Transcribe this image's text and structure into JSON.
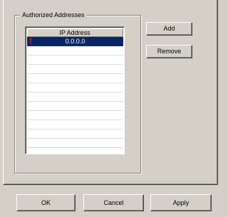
{
  "authorized": {
    "group_title": "Authorized Addresses",
    "column_header": "IP Address",
    "rows": [
      {
        "flag": "!",
        "ip": "0.0.0.0",
        "selected": true
      }
    ]
  },
  "buttons": {
    "add": "Add",
    "remove": "Remove",
    "ok": "OK",
    "cancel": "Cancel",
    "apply": "Apply"
  },
  "colors": {
    "dialog_background": "#d4d0c8",
    "selection_background": "#0a246a",
    "warning_flag": "#ff2020"
  },
  "icons": {
    "row_flag": "warning-flag-icon"
  }
}
